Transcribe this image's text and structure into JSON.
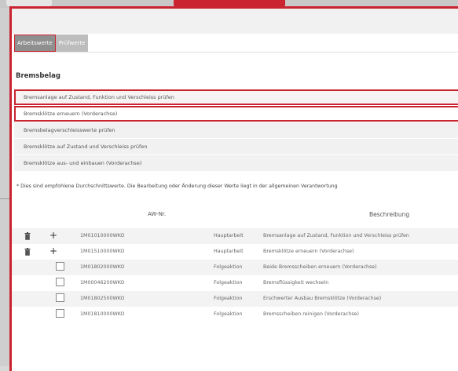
{
  "tabs": [
    {
      "label": "Arbeitswerte",
      "active": true
    },
    {
      "label": "Prüfwerte",
      "active": false
    }
  ],
  "section": {
    "title": "Bremsbelag"
  },
  "options": [
    {
      "label": "Bremsanlage auf Zustand, Funktion und Verschleiss prüfen",
      "selected": true
    },
    {
      "label": "Bremsklötze erneuern (Vorderachse)",
      "selected": true
    },
    {
      "label": "Bremsbelagverschleisswerte prüfen",
      "selected": false
    },
    {
      "label": "Bremsklötze auf Zustand und Verschleiss prüfen",
      "selected": false
    },
    {
      "label": "Bremsklötze aus- und einbauen (Vorderachse)",
      "selected": false
    }
  ],
  "note": "* Dies sind empfohlene Durchschnittswerte. Die Bearbeitung oder Änderung dieser Werte liegt in der allgemeinen Verantwortung",
  "table": {
    "headers": {
      "aw": "AW-Nr.",
      "description": "Beschreibung"
    },
    "rows": [
      {
        "aw": "1M01010000WKO",
        "type": "Hauptarbeit",
        "description": "Bremsanlage auf Zustand, Funktion und Verschleiss prüfen",
        "control": "delete-add"
      },
      {
        "aw": "1M01510000WKO",
        "type": "Hauptarbeit",
        "description": "Bremsklötze erneuern (Vorderachse)",
        "control": "delete-add"
      },
      {
        "aw": "1M01802000WKO",
        "type": "Folgeaktion",
        "description": "Beide Bremsscheiben erneuern (Vorderachse)",
        "control": "checkbox"
      },
      {
        "aw": "1M00046200WKO",
        "type": "Folgeaktion",
        "description": "Bremsflüssigkeit wechseln",
        "control": "checkbox"
      },
      {
        "aw": "1M01802500WKO",
        "type": "Folgeaktion",
        "description": "Erschwerter Ausbau Bremsklötze (Vorderachse)",
        "control": "checkbox"
      },
      {
        "aw": "1M01810000WKO",
        "type": "Folgeaktion",
        "description": "Bremsscheiben reinigen (Vorderachse)",
        "control": "checkbox"
      }
    ]
  },
  "colors": {
    "accent": "#c9242f"
  }
}
